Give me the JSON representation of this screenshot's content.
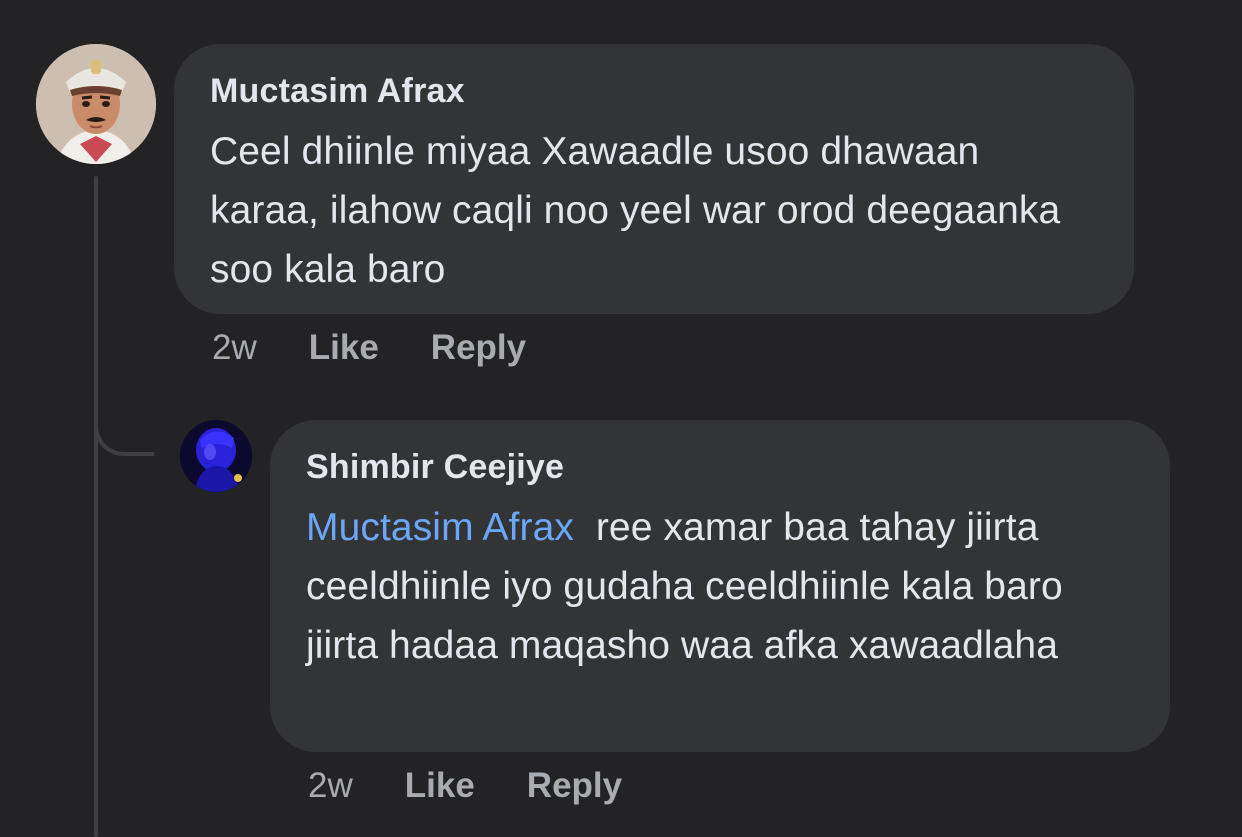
{
  "comments": [
    {
      "author": "Muctasim Afrax",
      "text": "Ceel dhiinle miyaa Xawaadle usoo dhawaan karaa, ilahow caqli noo yeel war orod deegaanka soo kala baro",
      "time": "2w",
      "like_label": "Like",
      "reply_label": "Reply"
    }
  ],
  "replies": [
    {
      "author": "Shimbir Ceejiye",
      "mention": "Muctasim Afrax",
      "text": "ree xamar baa tahay jiirta ceeldhiinle iyo gudaha ceeldhiinle kala baro jiirta hadaa maqasho waa  afka xawaadlaha",
      "time": "2w",
      "like_label": "Like",
      "reply_label": "Reply"
    }
  ],
  "colors": {
    "background": "#232325",
    "bubble": "#333436",
    "mention": "#6ca6f7",
    "meta": "#a8abaf"
  }
}
